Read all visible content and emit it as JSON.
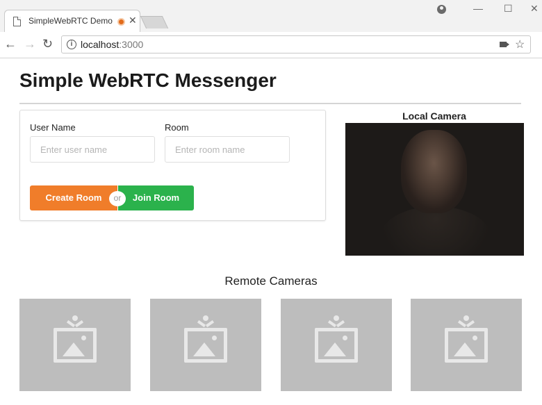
{
  "browser": {
    "tab_title": "SimpleWebRTC Demo",
    "url_host": "localhost",
    "url_port": ":3000"
  },
  "page": {
    "title": "Simple WebRTC Messenger"
  },
  "form": {
    "username_label": "User Name",
    "username_placeholder": "Enter user name",
    "room_label": "Room",
    "room_placeholder": "Enter room name",
    "create_label": "Create Room",
    "or_label": "or",
    "join_label": "Join Room"
  },
  "local": {
    "label": "Local Camera"
  },
  "remote": {
    "heading": "Remote Cameras",
    "tiles": [
      "camera-placeholder",
      "camera-placeholder",
      "camera-placeholder",
      "camera-placeholder"
    ]
  },
  "colors": {
    "create_button": "#f07d2a",
    "join_button": "#2bb24c",
    "placeholder_tile": "#bdbdbd"
  }
}
